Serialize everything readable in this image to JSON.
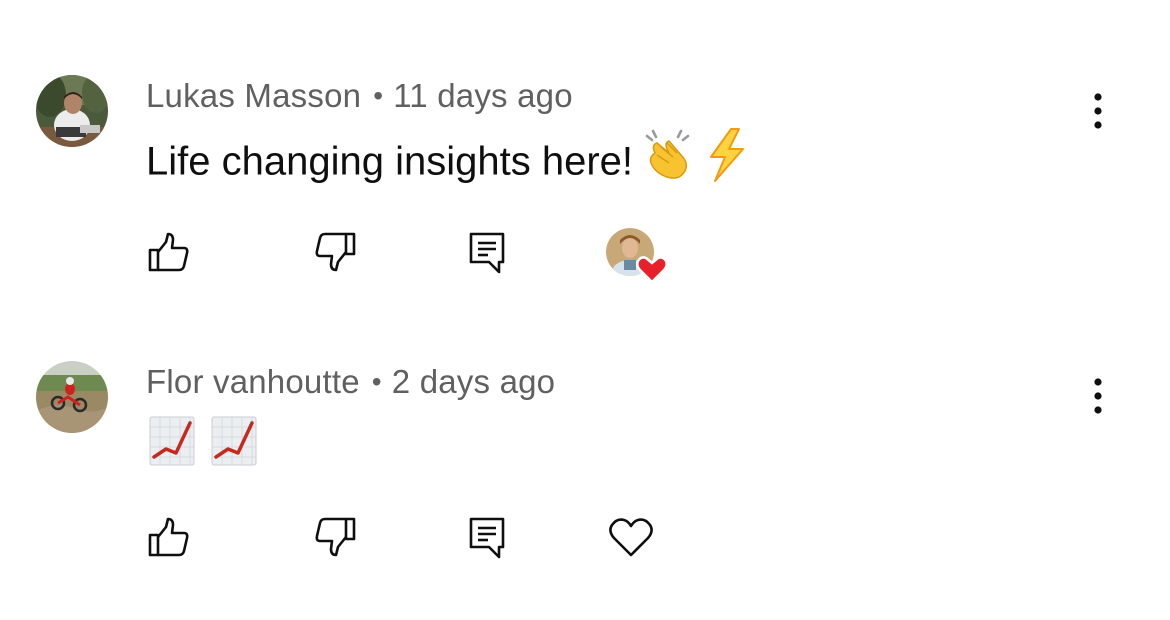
{
  "comments": [
    {
      "author": "Lukas Masson",
      "separator": "•",
      "time": "11 days ago",
      "text": "Life changing insights here!",
      "emojis": [
        "clapping-hands-icon",
        "lightning-icon"
      ],
      "hearted_by_creator": true
    },
    {
      "author": "Flor vanhoutte",
      "separator": "•",
      "time": "2 days ago",
      "text": "",
      "emojis": [
        "chart-increasing-icon",
        "chart-increasing-icon"
      ],
      "hearted_by_creator": false
    }
  ],
  "colors": {
    "meta_text": "#606060",
    "body_text": "#0f0f0f",
    "heart_red": "#e8202a",
    "icon": "#0f0f0f"
  }
}
